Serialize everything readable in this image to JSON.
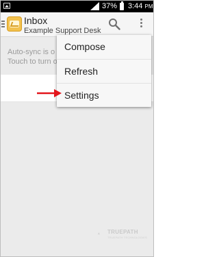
{
  "status_bar": {
    "battery_percent": "37%",
    "time": "3:44",
    "time_suffix": "PM",
    "icons": [
      "image-notification-icon",
      "signal-icon",
      "battery-icon"
    ]
  },
  "action_bar": {
    "title": "Inbox",
    "subtitle": "Example Support Desk",
    "icons": [
      "navigation-drawer-icon",
      "app-envelope-icon",
      "search-icon",
      "overflow-menu-icon"
    ]
  },
  "banner": {
    "line1": "Auto-sync is o",
    "line2": "Touch to turn o"
  },
  "menu": {
    "items": [
      {
        "label": "Compose"
      },
      {
        "label": "Refresh"
      },
      {
        "label": "Settings"
      }
    ]
  },
  "annotation": {
    "arrow_color": "#e3151b",
    "points_to": "Settings"
  },
  "watermark": {
    "brand": "TRUEPATH",
    "tagline": "TRUEPATH TECHNOLOGIES",
    "color": "#c9c9c9"
  },
  "colors": {
    "status_bar": "#000000",
    "action_bar": "#f5f5f5",
    "background": "#ebebeb",
    "menu": "#f7f7f7",
    "accent_icon": "#f2c14e"
  }
}
